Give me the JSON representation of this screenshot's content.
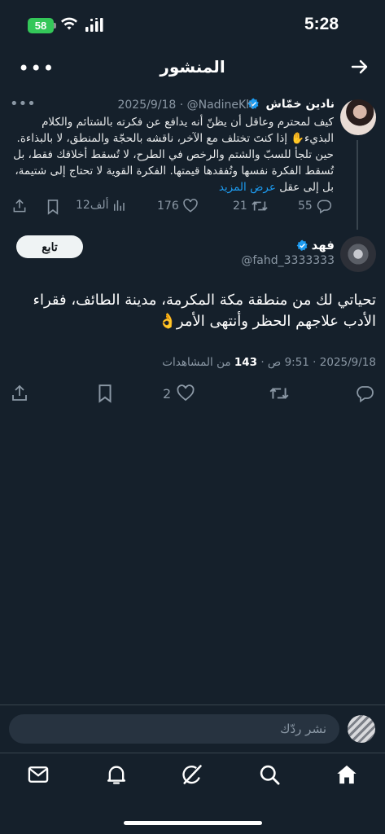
{
  "status_bar": {
    "time": "5:28",
    "battery": "58"
  },
  "header": {
    "title": "المنشور"
  },
  "parent_post": {
    "name": "نادين خمّاش",
    "handle": "@NadineKh",
    "date": "2025/9/18",
    "text": "كيف لمحترم وعاقل أن يظنّ أنه يدافع عن فكرته بالشتائم والكلام البذيء✋ إذا كنتَ تختلف مع الآخر، ناقشه بالحجّة والمنطق، لا بالبذاءة. حين تلجأ للسبّ والشتم والرخص في الطرح، لا تُسقط أخلاقك فقط، بل تُسقط الفكرة نفسها وتُفقدها قيمتها. الفكرة القوية لا تحتاج إلى شتيمة، بل إلى عقل",
    "show_more": "عرض المزيد",
    "replies": "55",
    "reposts": "21",
    "likes": "176",
    "views": "12ألف"
  },
  "main_post": {
    "name": "فهد",
    "handle": "@fahd_3333333",
    "follow_label": "تابع",
    "text": "تحياتي لك من منطقة مكة المكرمة، مدينة الطائف، فقراء الأدب علاجهم الحظر وأنتهى الأمر👌",
    "timestamp": "2025/9/18 · 9:51 ص · ",
    "views_count": "143",
    "views_label": " من المشاهدات",
    "likes": "2"
  },
  "compose": {
    "placeholder": "نشر ردّك"
  },
  "colors": {
    "background": "#15202b",
    "accent": "#1d9bf0",
    "muted": "#8b98a5",
    "battery": "#34c759"
  },
  "icons": [
    "wifi-icon",
    "signal-icon",
    "back-arrow-icon",
    "more-icon",
    "verified-icon",
    "reply-icon",
    "repost-icon",
    "like-icon",
    "views-icon",
    "bookmark-icon",
    "share-icon",
    "home-icon",
    "search-icon",
    "grok-icon",
    "bell-icon",
    "mail-icon"
  ]
}
